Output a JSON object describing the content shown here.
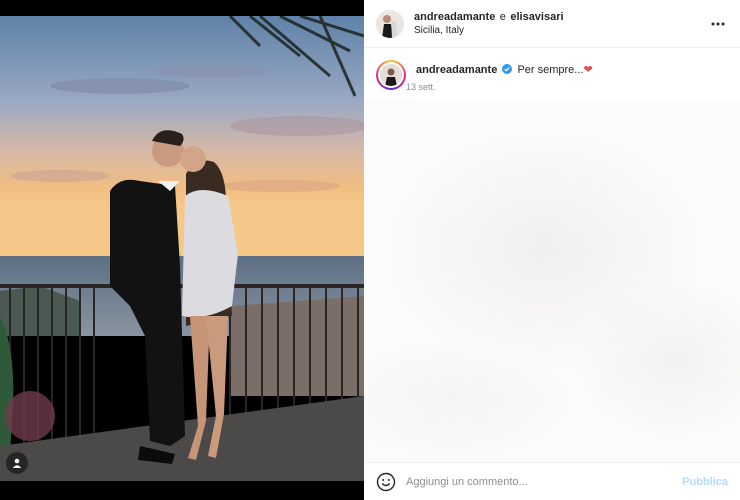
{
  "post": {
    "author_primary": "andreadamante",
    "conjunction": "e",
    "author_secondary": "elisavisari",
    "location": "Sicilia, Italy"
  },
  "caption": {
    "username": "andreadamante",
    "text": "Per sempre...",
    "heart": "❤",
    "time": "13 sett."
  },
  "comment": {
    "placeholder": "Aggiungi un commento...",
    "publish_label": "Pubblica"
  },
  "icons": {
    "more": "more-options-icon",
    "emoji": "emoji-icon",
    "verified": "verified-badge-icon",
    "tag": "user-tag-icon"
  },
  "colors": {
    "publish": "#b3dbff",
    "verified": "#3897f0",
    "heart": "#ed4956"
  }
}
